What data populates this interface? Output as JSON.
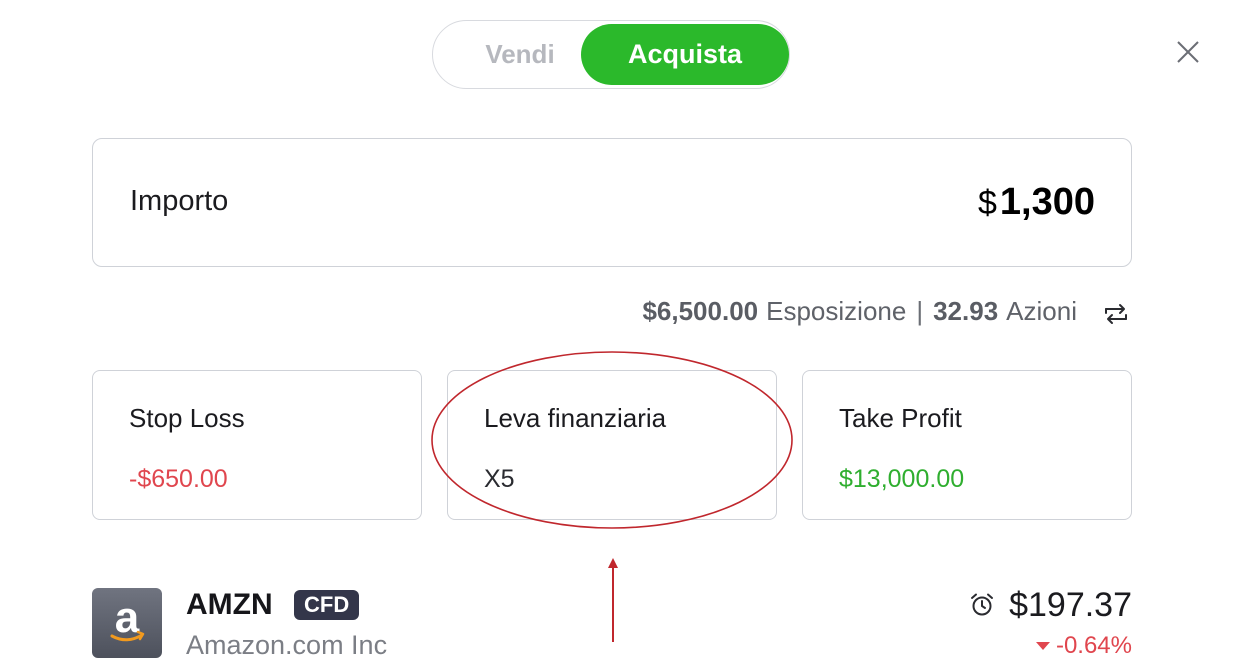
{
  "toggle": {
    "sell_label": "Vendi",
    "buy_label": "Acquista",
    "selected": "Acquista"
  },
  "amount": {
    "label": "Importo",
    "currency": "$",
    "value": "1,300"
  },
  "exposure": {
    "exposure_value": "$6,500.00",
    "exposure_label": "Esposizione",
    "separator": "|",
    "shares_value": "32.93",
    "shares_label": "Azioni"
  },
  "cards": {
    "stop_loss": {
      "title": "Stop Loss",
      "value": "-$650.00"
    },
    "leverage": {
      "title": "Leva finanziaria",
      "value": "X5"
    },
    "take_profit": {
      "title": "Take Profit",
      "value": "$13,000.00"
    }
  },
  "instrument": {
    "ticker": "AMZN",
    "badge": "CFD",
    "company": "Amazon.com Inc",
    "logo_letter": "a",
    "price": "$197.37",
    "change": "-0.64%"
  },
  "icons": {
    "close": "close-icon",
    "swap": "swap-icon",
    "clock": "alarm-clock-icon",
    "down": "triangle-down-icon"
  },
  "colors": {
    "buy_green": "#2bb92b",
    "loss_red": "#e0464e",
    "profit_green": "#2fae2f",
    "badge_bg": "#33364a",
    "annotation": "#c0272d"
  }
}
